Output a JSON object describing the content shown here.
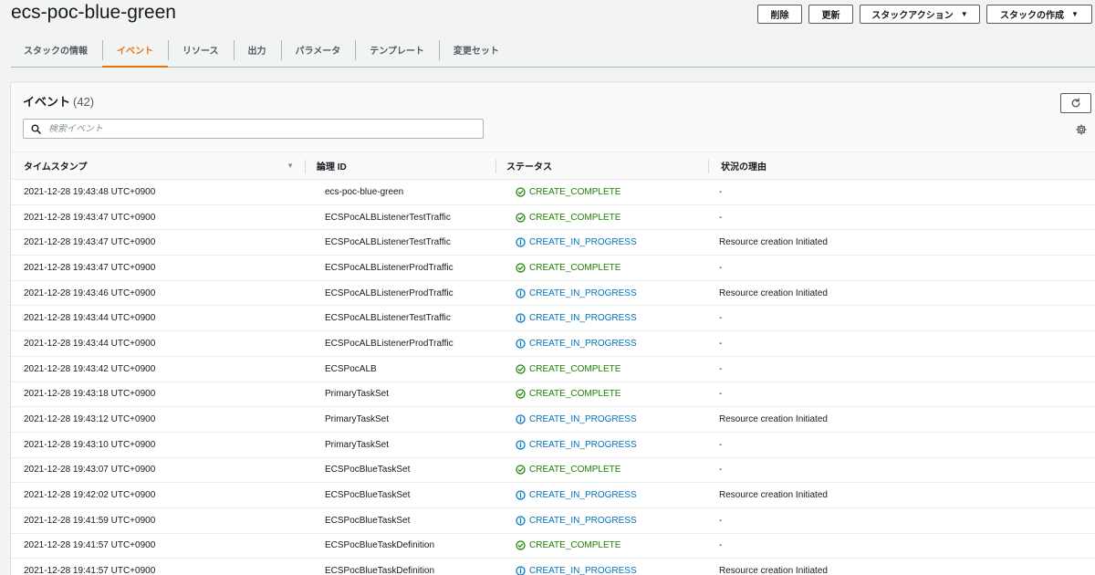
{
  "stack": {
    "name": "ecs-poc-blue-green"
  },
  "actions": {
    "delete": "削除",
    "update": "更新",
    "stack_actions": "スタックアクション",
    "create_stack": "スタックの作成",
    "caret": "▼"
  },
  "tabs": [
    {
      "label": "スタックの情報",
      "active": false
    },
    {
      "label": "イベント",
      "active": true
    },
    {
      "label": "リソース",
      "active": false
    },
    {
      "label": "出力",
      "active": false
    },
    {
      "label": "パラメータ",
      "active": false
    },
    {
      "label": "テンプレート",
      "active": false
    },
    {
      "label": "変更セット",
      "active": false
    }
  ],
  "events_panel": {
    "title": "イベント",
    "count": "(42)",
    "search_placeholder": "検索イベント",
    "columns": {
      "timestamp": "タイムスタンプ",
      "logical_id": "論理 ID",
      "status": "ステータス",
      "reason": "状況の理由"
    },
    "sort_icon": "▼"
  },
  "colors": {
    "accent": "#ec7211",
    "complete": "#1d8102",
    "in_progress": "#0073bb"
  },
  "events": [
    {
      "time": "2021-12-28 19:43:48 UTC+0900",
      "id": "ecs-poc-blue-green",
      "status": "CREATE_COMPLETE",
      "reason": "-"
    },
    {
      "time": "2021-12-28 19:43:47 UTC+0900",
      "id": "ECSPocALBListenerTestTraffic",
      "status": "CREATE_COMPLETE",
      "reason": "-"
    },
    {
      "time": "2021-12-28 19:43:47 UTC+0900",
      "id": "ECSPocALBListenerTestTraffic",
      "status": "CREATE_IN_PROGRESS",
      "reason": "Resource creation Initiated"
    },
    {
      "time": "2021-12-28 19:43:47 UTC+0900",
      "id": "ECSPocALBListenerProdTraffic",
      "status": "CREATE_COMPLETE",
      "reason": "-"
    },
    {
      "time": "2021-12-28 19:43:46 UTC+0900",
      "id": "ECSPocALBListenerProdTraffic",
      "status": "CREATE_IN_PROGRESS",
      "reason": "Resource creation Initiated"
    },
    {
      "time": "2021-12-28 19:43:44 UTC+0900",
      "id": "ECSPocALBListenerTestTraffic",
      "status": "CREATE_IN_PROGRESS",
      "reason": "-"
    },
    {
      "time": "2021-12-28 19:43:44 UTC+0900",
      "id": "ECSPocALBListenerProdTraffic",
      "status": "CREATE_IN_PROGRESS",
      "reason": "-"
    },
    {
      "time": "2021-12-28 19:43:42 UTC+0900",
      "id": "ECSPocALB",
      "status": "CREATE_COMPLETE",
      "reason": "-"
    },
    {
      "time": "2021-12-28 19:43:18 UTC+0900",
      "id": "PrimaryTaskSet",
      "status": "CREATE_COMPLETE",
      "reason": "-"
    },
    {
      "time": "2021-12-28 19:43:12 UTC+0900",
      "id": "PrimaryTaskSet",
      "status": "CREATE_IN_PROGRESS",
      "reason": "Resource creation Initiated"
    },
    {
      "time": "2021-12-28 19:43:10 UTC+0900",
      "id": "PrimaryTaskSet",
      "status": "CREATE_IN_PROGRESS",
      "reason": "-"
    },
    {
      "time": "2021-12-28 19:43:07 UTC+0900",
      "id": "ECSPocBlueTaskSet",
      "status": "CREATE_COMPLETE",
      "reason": "-"
    },
    {
      "time": "2021-12-28 19:42:02 UTC+0900",
      "id": "ECSPocBlueTaskSet",
      "status": "CREATE_IN_PROGRESS",
      "reason": "Resource creation Initiated"
    },
    {
      "time": "2021-12-28 19:41:59 UTC+0900",
      "id": "ECSPocBlueTaskSet",
      "status": "CREATE_IN_PROGRESS",
      "reason": "-"
    },
    {
      "time": "2021-12-28 19:41:57 UTC+0900",
      "id": "ECSPocBlueTaskDefinition",
      "status": "CREATE_COMPLETE",
      "reason": "-"
    },
    {
      "time": "2021-12-28 19:41:57 UTC+0900",
      "id": "ECSPocBlueTaskDefinition",
      "status": "CREATE_IN_PROGRESS",
      "reason": "Resource creation Initiated"
    }
  ]
}
